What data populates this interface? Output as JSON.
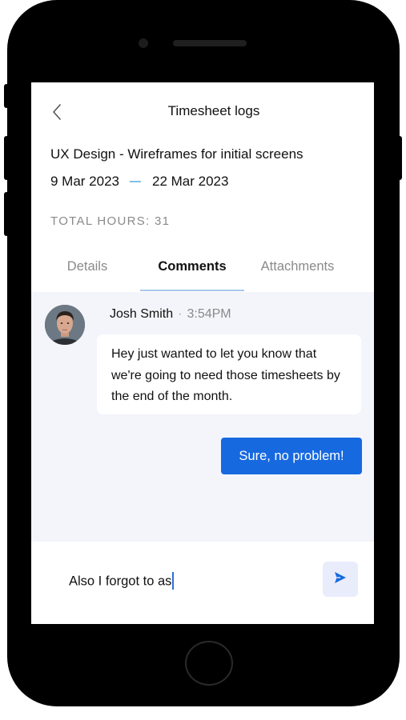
{
  "header": {
    "title": "Timesheet logs"
  },
  "project": {
    "title": "UX Design - Wireframes for initial screens",
    "start_date": "9 Mar 2023",
    "end_date": "22 Mar 2023"
  },
  "total_hours_label": "TOTAL HOURS: 31",
  "tabs": [
    {
      "label": "Details",
      "active": false
    },
    {
      "label": "Comments",
      "active": true
    },
    {
      "label": "Attachments",
      "active": false
    }
  ],
  "comments": {
    "incoming": {
      "author": "Josh Smith",
      "separator": "·",
      "time": "3:54PM",
      "text": "Hey just wanted to let you know that we're going to need those timesheets by the end of the month."
    },
    "outgoing": {
      "text": "Sure, no problem!"
    }
  },
  "composer": {
    "value": "Also I forgot to as"
  },
  "colors": {
    "accent": "#1769e0",
    "tab_underline": "#a9c7ec",
    "comments_bg": "#f4f5fb",
    "send_bg": "#e9ecfb"
  },
  "icons": {
    "back": "chevron-left-icon",
    "send": "send-icon"
  }
}
